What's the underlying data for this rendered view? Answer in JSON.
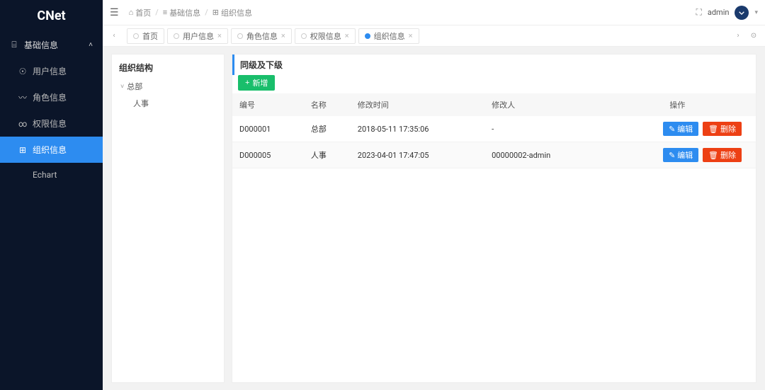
{
  "app": {
    "logo": "CNet"
  },
  "sidebar": {
    "group_label": "基础信息",
    "items": [
      {
        "label": "用户信息"
      },
      {
        "label": "角色信息"
      },
      {
        "label": "权限信息"
      },
      {
        "label": "组织信息"
      },
      {
        "label": "Echart"
      }
    ]
  },
  "topbar": {
    "breadcrumb": [
      {
        "label": "首页"
      },
      {
        "label": "基础信息"
      },
      {
        "label": "组织信息"
      }
    ],
    "user": "admin"
  },
  "tabs": [
    {
      "label": "首页",
      "active": false
    },
    {
      "label": "用户信息",
      "active": false
    },
    {
      "label": "角色信息",
      "active": false
    },
    {
      "label": "权限信息",
      "active": false
    },
    {
      "label": "组织信息",
      "active": true
    }
  ],
  "tree": {
    "header": "组织结构",
    "root": "总部",
    "children": [
      "人事"
    ]
  },
  "table": {
    "header": "同级及下级",
    "add_label": "新增",
    "edit_label": "编辑",
    "delete_label": "删除",
    "columns": [
      "编号",
      "名称",
      "修改时间",
      "修改人",
      "操作"
    ],
    "rows": [
      {
        "id": "D000001",
        "name": "总部",
        "time": "2018-05-11 17:35:06",
        "editor": "-"
      },
      {
        "id": "D000005",
        "name": "人事",
        "time": "2023-04-01 17:47:05",
        "editor": "00000002-admin"
      }
    ]
  }
}
